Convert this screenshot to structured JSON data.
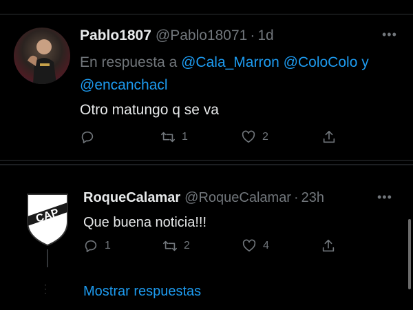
{
  "tweets": [
    {
      "name": "Pablo1807",
      "handle": "@Pablo18071",
      "time": "1d",
      "reply_prefix": "En respuesta a",
      "reply_mentions": [
        "@Cala_Marron",
        "@ColoColo"
      ],
      "reply_joiner": "y",
      "reply_last": "@encanchacl",
      "text": "Otro matungo q se va",
      "reply_count": "",
      "retweet_count": "1",
      "like_count": "2"
    },
    {
      "name": "RoqueCalamar",
      "handle": "@RoqueCalamar",
      "time": "23h",
      "text": "Que buena noticia!!!",
      "reply_count": "1",
      "retweet_count": "2",
      "like_count": "4",
      "avatar_text": "CAP"
    }
  ],
  "show_replies": "Mostrar respuestas",
  "colors": {
    "link": "#1d9bf0",
    "muted": "#71767b",
    "background": "#000000"
  },
  "icons": [
    "reply-icon",
    "retweet-icon",
    "like-icon",
    "share-icon",
    "more-icon"
  ]
}
